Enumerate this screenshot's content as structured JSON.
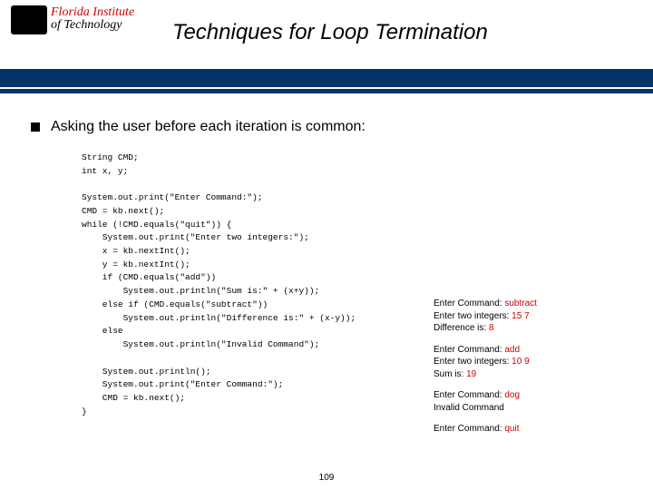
{
  "logo": {
    "line1": "Florida Institute",
    "line2": "of Technology"
  },
  "title": "Techniques for Loop Termination",
  "bullet": "Asking the user before each iteration is common:",
  "code": "String CMD;\nint x, y;\n\nSystem.out.print(\"Enter Command:\");\nCMD = kb.next();\nwhile (!CMD.equals(\"quit\")) {\n    System.out.print(\"Enter two integers:\");\n    x = kb.nextInt();\n    y = kb.nextInt();\n    if (CMD.equals(\"add\"))\n        System.out.println(\"Sum is:\" + (x+y));\n    else if (CMD.equals(\"subtract\"))\n        System.out.println(\"Difference is:\" + (x-y));\n    else\n        System.out.println(\"Invalid Command\");\n\n    System.out.println();\n    System.out.print(\"Enter Command:\");\n    CMD = kb.next();\n}",
  "output": {
    "block1": {
      "l1a": "Enter Command: ",
      "l1b": "subtract",
      "l2a": "Enter two integers: ",
      "l2b": "15",
      "l2c": "  ",
      "l2d": "7",
      "l3a": "Difference is: ",
      "l3b": "8"
    },
    "block2": {
      "l1a": "Enter Command: ",
      "l1b": "add",
      "l2a": "Enter two integers: ",
      "l2b": "10",
      "l2c": "  ",
      "l2d": "9",
      "l3a": "Sum is: ",
      "l3b": "19"
    },
    "block3": {
      "l1a": "Enter Command: ",
      "l1b": "dog",
      "l2a": "Invalid Command"
    },
    "block4": {
      "l1a": "Enter Command: ",
      "l1b": "quit"
    }
  },
  "page_number": "109"
}
